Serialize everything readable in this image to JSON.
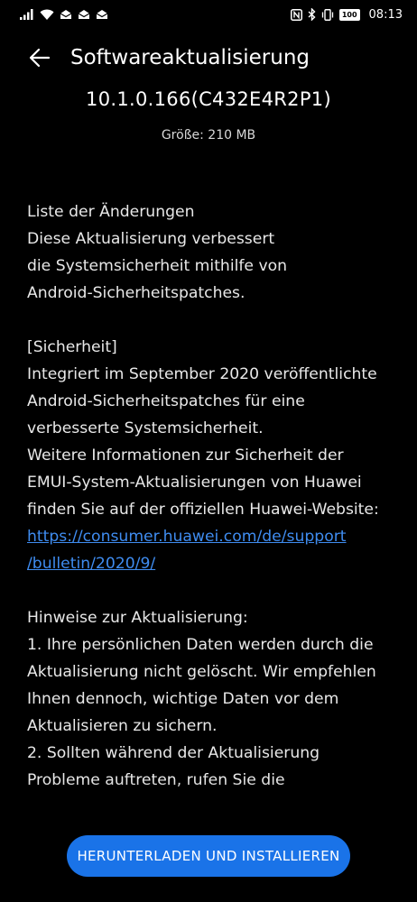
{
  "status_bar": {
    "battery": "100",
    "time": "08:13",
    "icons_left": [
      "signal-icon",
      "wifi-icon",
      "mail-icon",
      "mail-icon",
      "mail-icon"
    ],
    "icons_right": [
      "nfc-icon",
      "bluetooth-icon",
      "vibrate-icon"
    ]
  },
  "header": {
    "title": "Softwareaktualisierung"
  },
  "update": {
    "version": "10.1.0.166(C432E4R2P1)",
    "size": "Größe: 210 MB"
  },
  "changelog": {
    "heading": "Liste der Änderungen",
    "intro": "Diese Aktualisierung verbessert\ndie Systemsicherheit mithilfe von\nAndroid-Sicherheitspatches.",
    "security_heading": "[Sicherheit]",
    "security_text": "Integriert im September 2020 veröffentlichte\nAndroid-Sicherheitspatches für eine\nverbesserte Systemsicherheit.\nWeitere Informationen zur Sicherheit der\nEMUI-System-Aktualisierungen von Huawei\nfinden Sie auf der offiziellen Huawei-Website:",
    "link": "https://consumer.huawei.com/de/support\n/bulletin/2020/9/",
    "notes_heading": "Hinweise zur Aktualisierung:",
    "notes_text": "1. Ihre persönlichen Daten werden durch die\nAktualisierung nicht gelöscht. Wir empfehlen\nIhnen dennoch, wichtige Daten vor dem\nAktualisieren zu sichern.\n2. Sollten während der Aktualisierung\nProbleme auftreten, rufen Sie die"
  },
  "actions": {
    "install_label": "HERUNTERLADEN UND INSTALLIEREN"
  },
  "colors": {
    "background": "#000000",
    "accent": "#1a73e8",
    "link": "#3f8cf0"
  }
}
